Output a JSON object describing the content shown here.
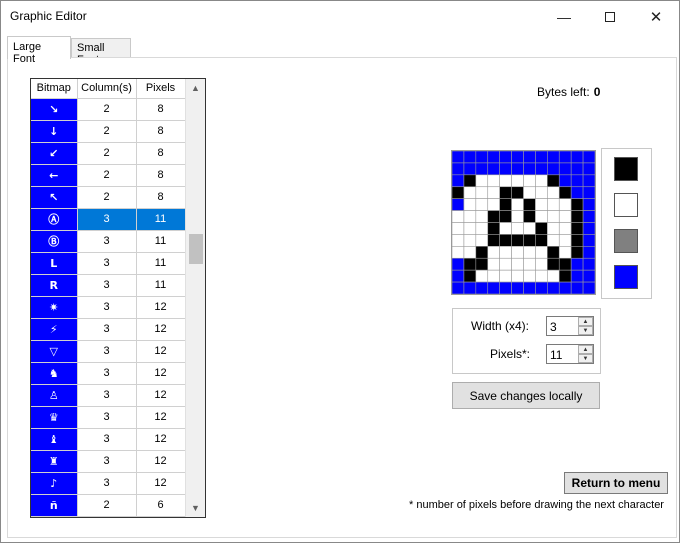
{
  "window": {
    "title": "Graphic Editor",
    "minimize_icon": "minimize-icon",
    "maximize_icon": "maximize-icon",
    "close_icon": "close-icon"
  },
  "tabs": [
    {
      "label": "Large Font",
      "active": true
    },
    {
      "label": "Small Font",
      "active": false
    }
  ],
  "grid": {
    "headers": [
      "Bitmap",
      "Column(s)",
      "Pixels"
    ],
    "rows": [
      {
        "glyph": "↘",
        "columns": "2",
        "pixels": "8"
      },
      {
        "glyph": "↓",
        "columns": "2",
        "pixels": "8"
      },
      {
        "glyph": "↙",
        "columns": "2",
        "pixels": "8"
      },
      {
        "glyph": "←",
        "columns": "2",
        "pixels": "8"
      },
      {
        "glyph": "↖",
        "columns": "2",
        "pixels": "8"
      },
      {
        "glyph": "Ⓐ",
        "columns": "3",
        "pixels": "11",
        "selected": true
      },
      {
        "glyph": "Ⓑ",
        "columns": "3",
        "pixels": "11"
      },
      {
        "glyph": "L",
        "columns": "3",
        "pixels": "11"
      },
      {
        "glyph": "R",
        "columns": "3",
        "pixels": "11"
      },
      {
        "glyph": "✷",
        "columns": "3",
        "pixels": "12"
      },
      {
        "glyph": "⚡",
        "columns": "3",
        "pixels": "12"
      },
      {
        "glyph": "▽",
        "columns": "3",
        "pixels": "12"
      },
      {
        "glyph": "♞",
        "columns": "3",
        "pixels": "12"
      },
      {
        "glyph": "♙",
        "columns": "3",
        "pixels": "12"
      },
      {
        "glyph": "♛",
        "columns": "3",
        "pixels": "12"
      },
      {
        "glyph": "♝",
        "columns": "3",
        "pixels": "12"
      },
      {
        "glyph": "♜",
        "columns": "3",
        "pixels": "12"
      },
      {
        "glyph": "♪",
        "columns": "3",
        "pixels": "12"
      },
      {
        "glyph": "ñ",
        "columns": "2",
        "pixels": "6"
      }
    ],
    "scroll_up_icon": "scroll-up-arrow-icon",
    "scroll_down_icon": "scroll-down-arrow-icon"
  },
  "bytes_left": {
    "label": "Bytes left:",
    "value": "0"
  },
  "bitmap": {
    "cols": 12,
    "rows": 12,
    "pixels": [
      "BBBBBBBBBBBB",
      "BBBBBBBBBBBB",
      "BKWWWWWWKBBB",
      "KWWWKKWWWKBB",
      "BWWWKWKWWWKB",
      "WWWKKWKWWWKB",
      "WWWKWWWKWWKB",
      "WWWKKKKKWWKB",
      "WWKWWWWWKWKB",
      "BKKWWWWWKKBB",
      "BKWWWWWWWKBB",
      "BBBBBBBBBBBB"
    ],
    "colors": {
      "B": "#0000ff",
      "K": "#000000",
      "W": "#ffffff"
    }
  },
  "palette": [
    {
      "name": "black-swatch",
      "color": "#000000"
    },
    {
      "name": "white-swatch",
      "color": "#ffffff"
    },
    {
      "name": "gray-swatch",
      "color": "#808080"
    },
    {
      "name": "blue-swatch",
      "color": "#0000ff"
    }
  ],
  "props": {
    "width_label": "Width (x4):",
    "width_value": "3",
    "pixels_label": "Pixels*:",
    "pixels_value": "11"
  },
  "buttons": {
    "save": "Save changes locally",
    "return": "Return to menu"
  },
  "note": "* number of pixels before drawing the next character"
}
